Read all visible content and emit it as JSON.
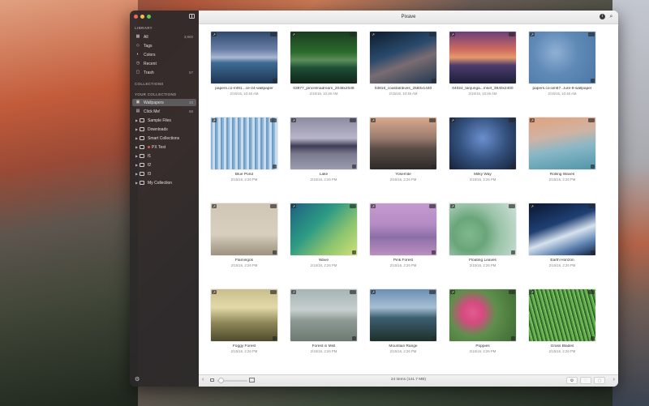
{
  "window": {
    "title": "Pixave"
  },
  "sidebar": {
    "library_title": "LIBRARY",
    "library_items": [
      {
        "label": "All",
        "count": "3,800",
        "icon": "grid-icon"
      },
      {
        "label": "Tags",
        "count": "",
        "icon": "tag-icon"
      },
      {
        "label": "Colors",
        "count": "",
        "icon": "palette-icon"
      },
      {
        "label": "Recent",
        "count": "",
        "icon": "clock-icon"
      },
      {
        "label": "Trash",
        "count": "57",
        "icon": "trash-icon"
      }
    ],
    "collections_title": "COLLECTIONS",
    "your_collections_title": "YOUR COLLECTIONS",
    "collections": [
      {
        "label": "Wallpapers",
        "count": "20",
        "selected": true,
        "icon": "image-icon"
      },
      {
        "label": "Click Me!",
        "count": "68",
        "selected": false,
        "icon": "cursor-icon"
      },
      {
        "label": "Sample Files",
        "count": "",
        "selected": false,
        "icon": "folder-icon"
      },
      {
        "label": "Downloads",
        "count": "",
        "selected": false,
        "icon": "folder-icon"
      },
      {
        "label": "Smart Collections",
        "count": "",
        "selected": false,
        "icon": "folder-icon"
      },
      {
        "label": "PX Test",
        "count": "",
        "selected": false,
        "icon": "red-dot-folder-icon"
      },
      {
        "label": "f1",
        "count": "",
        "selected": false,
        "icon": "folder-icon"
      },
      {
        "label": "f2",
        "count": "",
        "selected": false,
        "icon": "folder-icon"
      },
      {
        "label": "f3",
        "count": "",
        "selected": false,
        "icon": "folder-icon"
      },
      {
        "label": "My Collection",
        "count": "",
        "selected": false,
        "icon": "folder-icon"
      }
    ]
  },
  "grid": [
    {
      "name": "papers.co-mf81...ce-24-wallpaper",
      "date": "2/15/16, 10:46 AM"
    },
    {
      "name": "03877_pincelmadream_2048x2048",
      "date": "2/15/16, 10:46 AM"
    },
    {
      "name": "03816_coastalrdives_2560x1440",
      "date": "2/15/16, 10:46 AM"
    },
    {
      "name": "04024_tanjunga...mset_3840x2400",
      "date": "2/15/16, 10:46 AM"
    },
    {
      "name": "papers.co-am67...lure-9-wallpaper",
      "date": "2/15/16, 10:46 AM"
    },
    {
      "name": "Blue Pond",
      "date": "2/15/16, 2:26 PM"
    },
    {
      "name": "Lake",
      "date": "2/15/16, 2:26 PM"
    },
    {
      "name": "Yosemite",
      "date": "2/15/16, 2:26 PM"
    },
    {
      "name": "Milky Way",
      "date": "2/15/16, 2:26 PM"
    },
    {
      "name": "Rolling Waves",
      "date": "2/15/16, 2:26 PM"
    },
    {
      "name": "Flamingos",
      "date": "2/15/16, 2:26 PM"
    },
    {
      "name": "Wave",
      "date": "2/15/16, 2:26 PM"
    },
    {
      "name": "Pink Forest",
      "date": "2/15/16, 2:26 PM"
    },
    {
      "name": "Floating Leaves",
      "date": "2/15/16, 2:26 PM"
    },
    {
      "name": "Earth Horizon",
      "date": "2/15/16, 2:26 PM"
    },
    {
      "name": "Foggy Forest",
      "date": "2/15/16, 2:26 PM"
    },
    {
      "name": "Forest in Mist",
      "date": "2/15/16, 2:26 PM"
    },
    {
      "name": "Mountain Range",
      "date": "2/15/16, 2:26 PM"
    },
    {
      "name": "Poppies",
      "date": "2/15/16, 2:26 PM"
    },
    {
      "name": "Grass Blades",
      "date": "2/15/16, 2:26 PM"
    }
  ],
  "bottombar": {
    "status": "24 items (141.7 MB)"
  }
}
